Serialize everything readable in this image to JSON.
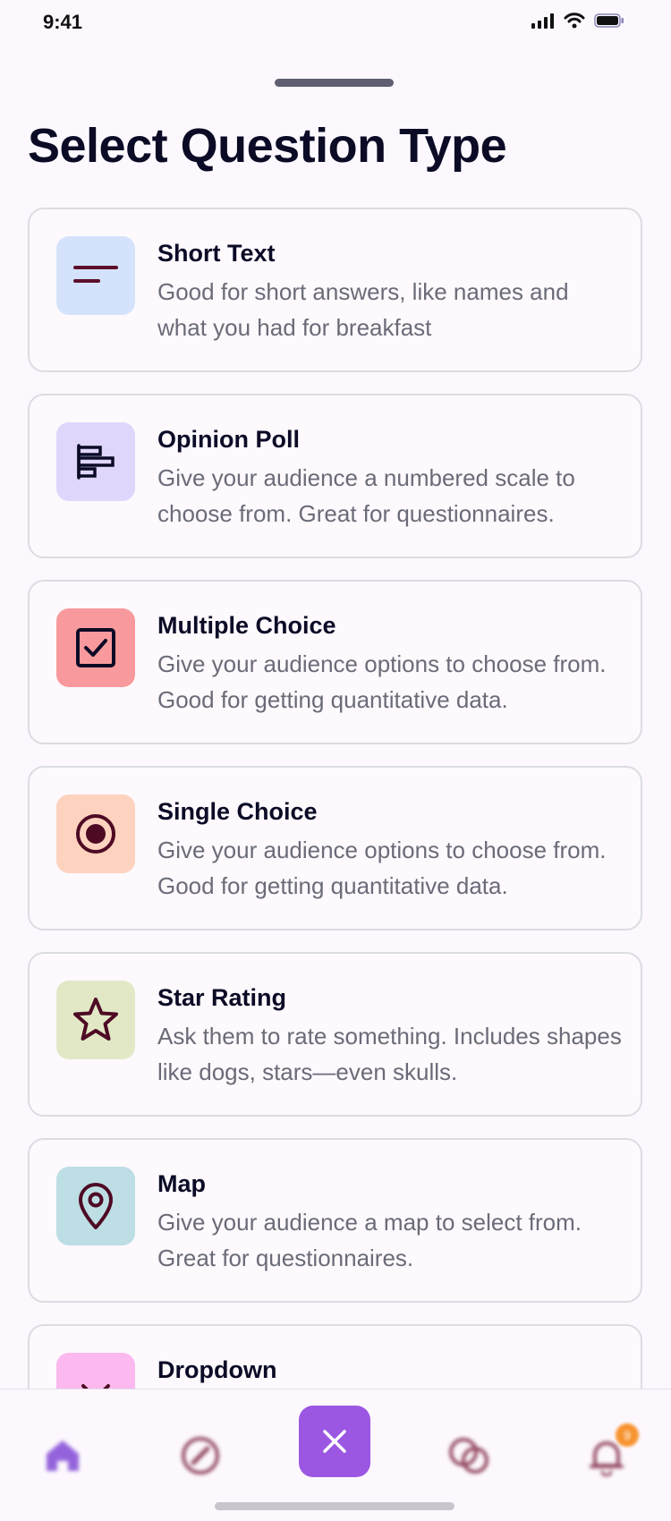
{
  "status_bar": {
    "time": "9:41"
  },
  "page": {
    "title": "Select Question Type"
  },
  "question_types": [
    {
      "title": "Short Text",
      "description": "Good for short answers, like names and what you had for breakfast",
      "icon": "short-text-icon",
      "icon_bg": "#d4e3fb"
    },
    {
      "title": "Opinion Poll",
      "description": "Give your audience a numbered scale to choose from. Great for questionnaires.",
      "icon": "bar-chart-icon",
      "icon_bg": "#e0d6fb"
    },
    {
      "title": "Multiple Choice",
      "description": "Give your audience options to choose from. Good for getting quantitative data.",
      "icon": "checkbox-icon",
      "icon_bg": "#f89a9d"
    },
    {
      "title": "Single Choice",
      "description": "Give your audience options to choose from. Good for getting quantitative data.",
      "icon": "radio-icon",
      "icon_bg": "#fdd3bf"
    },
    {
      "title": "Star Rating",
      "description": "Ask them to rate something. Includes shapes like dogs, stars—even skulls.",
      "icon": "star-icon",
      "icon_bg": "#e2e8c6"
    },
    {
      "title": "Map",
      "description": "Give your audience a map to select from. Great for questionnaires.",
      "icon": "map-pin-icon",
      "icon_bg": "#bcdee4"
    },
    {
      "title": "Dropdown",
      "description": "",
      "icon": "chevron-down-icon",
      "icon_bg": "#fbb9ef"
    }
  ],
  "tab_bar": {
    "items": [
      "home-icon",
      "compass-icon",
      "close-icon",
      "chat-icon",
      "bell-icon"
    ],
    "badge": "9",
    "accent_color": "#9b56e2"
  }
}
